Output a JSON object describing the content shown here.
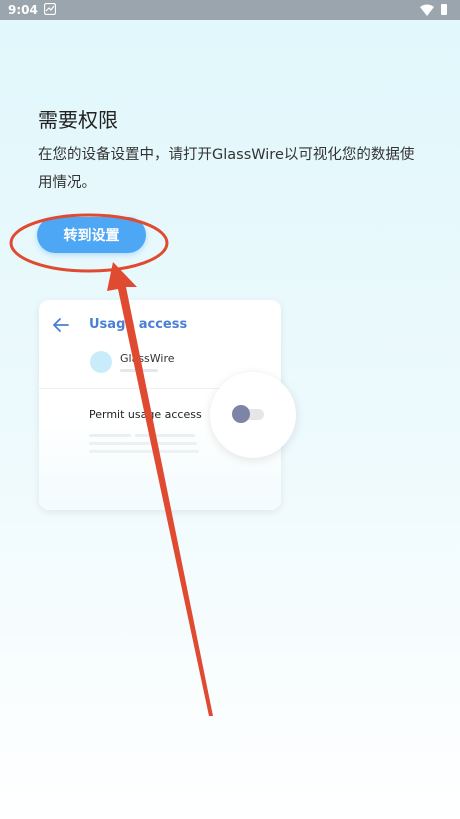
{
  "status_bar": {
    "time": "9:04"
  },
  "permission": {
    "title": "需要权限",
    "description": "在您的设备设置中，请打开GlassWire以可视化您的数据使用情况。",
    "button_label": "转到设置"
  },
  "preview": {
    "title": "Usage access",
    "app_name": "GlassWire",
    "permit_label": "Permit usage access",
    "toggle_on": false
  },
  "colors": {
    "accent": "#4ea7f5",
    "annotation": "#e04a30",
    "preview_title": "#4a7fd4"
  }
}
